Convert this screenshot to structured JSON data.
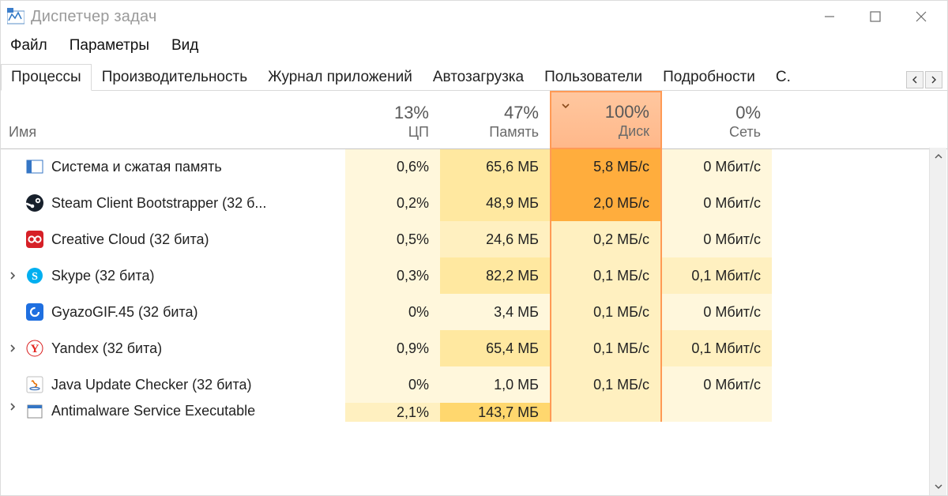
{
  "titlebar": {
    "title": "Диспетчер задач"
  },
  "menu": {
    "items": [
      "Файл",
      "Параметры",
      "Вид"
    ]
  },
  "tabs": {
    "items": [
      "Процессы",
      "Производительность",
      "Журнал приложений",
      "Автозагрузка",
      "Пользователи",
      "Подробности",
      "С."
    ],
    "active_index": 0
  },
  "columns": {
    "name_label": "Имя",
    "cpu": {
      "pct": "13%",
      "label": "ЦП"
    },
    "mem": {
      "pct": "47%",
      "label": "Память"
    },
    "disk": {
      "pct": "100%",
      "label": "Диск",
      "sorted": true
    },
    "net": {
      "pct": "0%",
      "label": "Сеть"
    }
  },
  "rows": [
    {
      "icon": "system",
      "expand": false,
      "name": "Система и сжатая память",
      "cpu": "0,6%",
      "mem": "65,6 МБ",
      "disk": "5,8 МБ/с",
      "net": "0 Мбит/с",
      "heat": {
        "cpu": 1,
        "mem": 3,
        "disk": 6,
        "net": 1
      }
    },
    {
      "icon": "steam",
      "expand": false,
      "name": "Steam Client Bootstrapper (32 б...",
      "cpu": "0,2%",
      "mem": "48,9 МБ",
      "disk": "2,0 МБ/с",
      "net": "0 Мбит/с",
      "heat": {
        "cpu": 1,
        "mem": 3,
        "disk": 6,
        "net": 1
      }
    },
    {
      "icon": "adobe",
      "expand": false,
      "name": "Creative Cloud (32 бита)",
      "cpu": "0,5%",
      "mem": "24,6 МБ",
      "disk": "0,2 МБ/с",
      "net": "0 Мбит/с",
      "heat": {
        "cpu": 1,
        "mem": 2,
        "disk": 2,
        "net": 1
      }
    },
    {
      "icon": "skype",
      "expand": true,
      "name": "Skype (32 бита)",
      "cpu": "0,3%",
      "mem": "82,2 МБ",
      "disk": "0,1 МБ/с",
      "net": "0,1 Мбит/с",
      "heat": {
        "cpu": 1,
        "mem": 3,
        "disk": 2,
        "net": 2
      }
    },
    {
      "icon": "gyazo",
      "expand": false,
      "name": "GyazoGIF.45 (32 бита)",
      "cpu": "0%",
      "mem": "3,4 МБ",
      "disk": "0,1 МБ/с",
      "net": "0 Мбит/с",
      "heat": {
        "cpu": 1,
        "mem": 1,
        "disk": 2,
        "net": 1
      }
    },
    {
      "icon": "yandex",
      "expand": true,
      "name": "Yandex (32 бита)",
      "cpu": "0,9%",
      "mem": "65,4 МБ",
      "disk": "0,1 МБ/с",
      "net": "0,1 Мбит/с",
      "heat": {
        "cpu": 1,
        "mem": 3,
        "disk": 2,
        "net": 2
      }
    },
    {
      "icon": "java",
      "expand": false,
      "name": "Java Update Checker (32 бита)",
      "cpu": "0%",
      "mem": "1,0 МБ",
      "disk": "0,1 МБ/с",
      "net": "0 Мбит/с",
      "heat": {
        "cpu": 1,
        "mem": 1,
        "disk": 2,
        "net": 1
      }
    },
    {
      "icon": "generic",
      "expand": true,
      "name": "Antimalware Service Executable",
      "cpu": "2,1%",
      "mem": "143,7 МБ",
      "disk": "",
      "net": "",
      "heat": {
        "cpu": 2,
        "mem": 4,
        "disk": 2,
        "net": 1
      },
      "partial": true
    }
  ]
}
